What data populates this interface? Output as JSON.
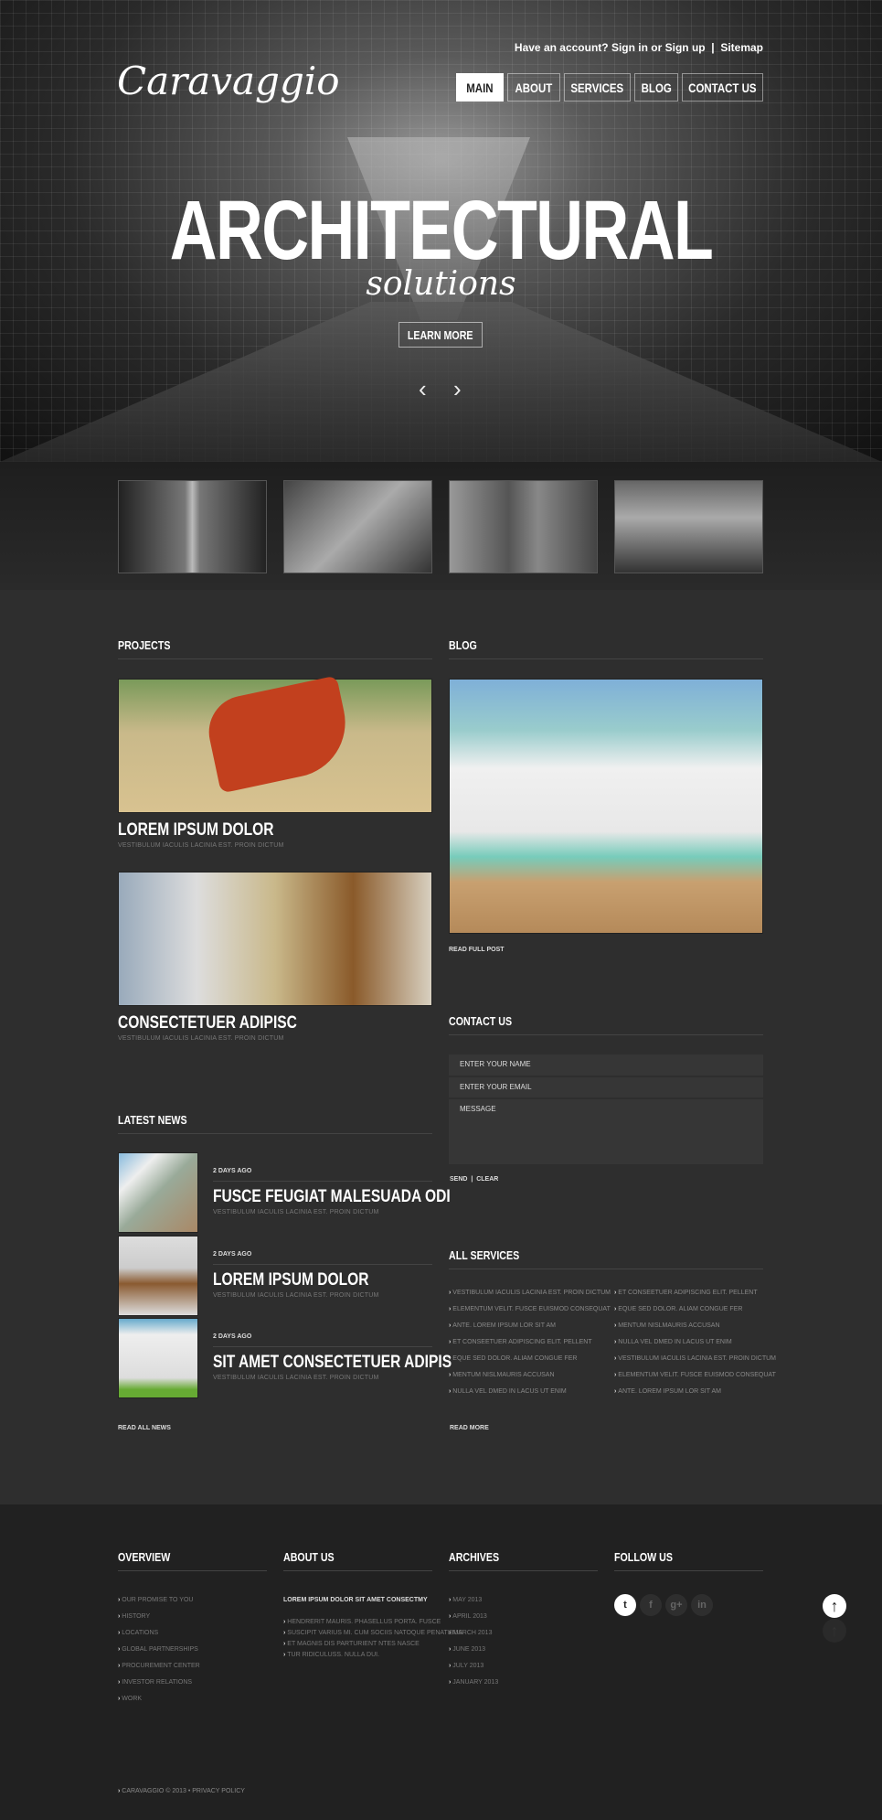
{
  "header": {
    "account_text": "Have an account? Sign in or Sign up",
    "sitemap": "Sitemap",
    "logo": "Caravaggio",
    "nav": [
      "MAIN",
      "ABOUT",
      "SERVICES",
      "BLOG",
      "CONTACT US"
    ]
  },
  "hero": {
    "title": "ARCHITECTURAL",
    "subtitle": "solutions",
    "button": "LEARN MORE",
    "prev": "‹",
    "next": "›"
  },
  "projects": {
    "heading": "PROJECTS",
    "items": [
      {
        "title": "LOREM IPSUM DOLOR",
        "subtitle": "VESTIBULUM IACULIS LACINIA EST. PROIN DICTUM"
      },
      {
        "title": "CONSECTETUER ADIPISC",
        "subtitle": "VESTIBULUM IACULIS LACINIA EST. PROIN DICTUM"
      }
    ]
  },
  "blog": {
    "heading": "BLOG",
    "read_more": "READ FULL POST"
  },
  "contact": {
    "heading": "CONTACT US",
    "name_placeholder": "ENTER YOUR NAME",
    "email_placeholder": "ENTER YOUR EMAIL",
    "message_placeholder": "MESSAGE",
    "send": "SEND",
    "separator": "|",
    "clear": "CLEAR"
  },
  "news": {
    "heading": "LATEST NEWS",
    "read_all": "READ ALL NEWS",
    "items": [
      {
        "date": "2 DAYS AGO",
        "title": "FUSCE FEUGIAT MALESUADA ODI",
        "subtitle": "VESTIBULUM IACULIS LACINIA EST. PROIN DICTUM"
      },
      {
        "date": "2 DAYS AGO",
        "title": "LOREM IPSUM DOLOR",
        "subtitle": "VESTIBULUM IACULIS LACINIA EST. PROIN DICTUM"
      },
      {
        "date": "2 DAYS AGO",
        "title": "SIT AMET CONSECTETUER ADIPIS",
        "subtitle": "VESTIBULUM IACULIS LACINIA EST. PROIN DICTUM"
      }
    ]
  },
  "services": {
    "heading": "ALL SERVICES",
    "read_more": "READ MORE",
    "left": [
      "VESTIBULUM IACULIS LACINIA EST. PROIN DICTUM",
      "ELEMENTUM VELIT. FUSCE EUISMOD CONSEQUAT",
      "ANTE. LOREM IPSUM LOR SIT AM",
      "ET CONSEETUER ADIPISCING ELIT. PELLENT",
      "EQUE SED DOLOR. ALIAM CONGUE FER",
      "MENTUM NISLMAURIS ACCUSAN",
      "NULLA VEL DMED IN LACUS UT ENIM"
    ],
    "right": [
      "ET CONSEETUER ADIPISCING ELIT. PELLENT",
      "EQUE SED DOLOR. ALIAM CONGUE FER",
      "MENTUM NISLMAURIS ACCUSAN",
      "NULLA VEL DMED IN LACUS UT ENIM",
      "VESTIBULUM IACULIS LACINIA EST. PROIN DICTUM",
      "ELEMENTUM VELIT. FUSCE EUISMOD CONSEQUAT",
      "ANTE. LOREM IPSUM LOR SIT AM"
    ]
  },
  "footer": {
    "overview": {
      "heading": "OVERVIEW",
      "items": [
        "OUR PROMISE TO YOU",
        "HISTORY",
        "LOCATIONS",
        "GLOBAL PARTNERSHIPS",
        "PROCUREMENT CENTER",
        "INVESTOR RELATIONS",
        "WORK"
      ]
    },
    "about": {
      "heading": "ABOUT US",
      "lead": "LOREM IPSUM DOLOR SIT AMET CONSECTMY",
      "lines": [
        "HENDRERIT MAURIS. PHASELLUS PORTA. FUSCE",
        "SUSCIPIT VARIUS MI. CUM SOCIIS NATOQUE PENATIBUS",
        "ET MAGNIS DIS PARTURIENT NTES NASCE",
        "TUR RIDICULUSS. NULLA DUI."
      ]
    },
    "archives": {
      "heading": "ARCHIVES",
      "items": [
        "MAY 2013",
        "APRIL 2013",
        "MARCH 2013",
        "JUNE 2013",
        "JULY 2013",
        "JANUARY 2013"
      ]
    },
    "follow": {
      "heading": "FOLLOW US",
      "icons": [
        "twitter-icon",
        "facebook-icon",
        "google-plus-icon",
        "linkedin-icon"
      ],
      "glyphs": [
        "t",
        "f",
        "g+",
        "in"
      ]
    },
    "copyright": "CARAVAGGIO © 2013 • PRIVACY POLICY",
    "to_top": "↑"
  }
}
